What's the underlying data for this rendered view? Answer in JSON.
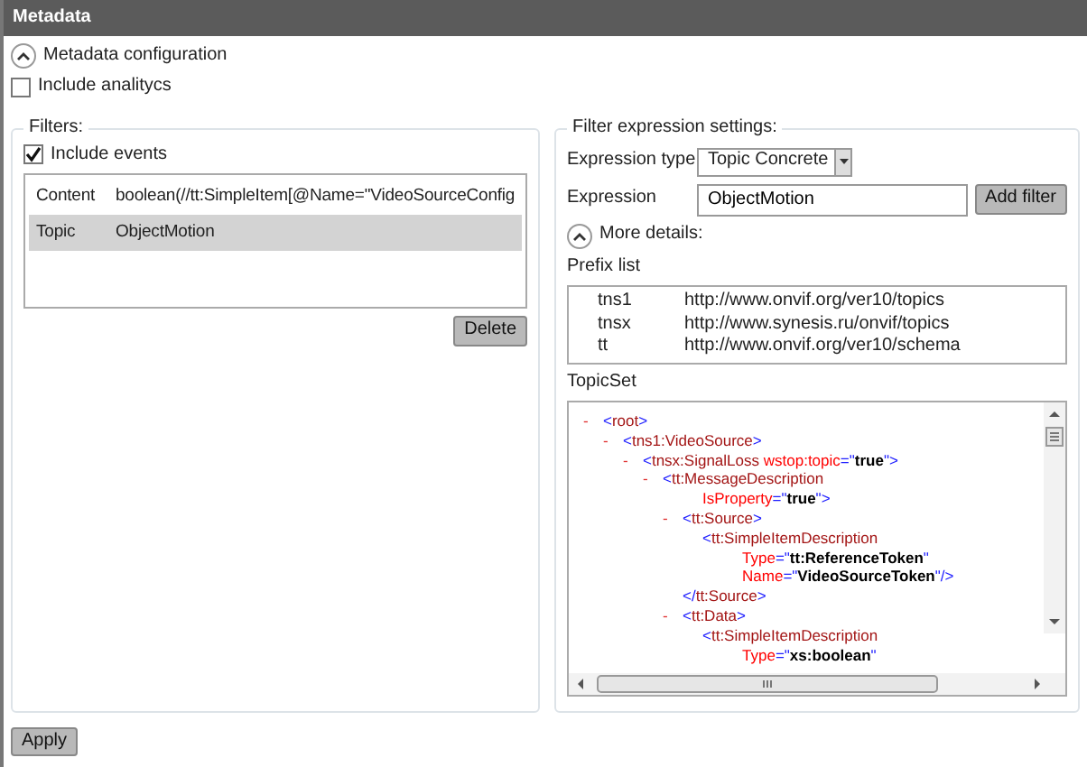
{
  "window": {
    "title": "Metadata"
  },
  "section": {
    "label": "Metadata configuration",
    "expanded": true
  },
  "include_analytics": {
    "label": "Include analitycs",
    "checked": false
  },
  "filters": {
    "legend": "Filters:",
    "include_events": {
      "label": "Include events",
      "checked": true
    },
    "rows": [
      {
        "type": "Content",
        "value": "boolean(//tt:SimpleItem[@Name=\"VideoSourceConfig",
        "selected": false
      },
      {
        "type": "Topic",
        "value": "ObjectMotion",
        "selected": true
      }
    ],
    "delete_button": "Delete"
  },
  "settings": {
    "legend": "Filter expression settings:",
    "expression_type": {
      "label": "Expression type",
      "value": "Topic  Concrete"
    },
    "expression": {
      "label": "Expression",
      "value": "ObjectMotion"
    },
    "add_button": "Add filter",
    "details": {
      "label": "More details:",
      "expanded": true
    },
    "prefix_list": {
      "label": "Prefix list",
      "rows": [
        {
          "prefix": "tns1",
          "uri": "http://www.onvif.org/ver10/topics"
        },
        {
          "prefix": "tnsx",
          "uri": "http://www.synesis.ru/onvif/topics"
        },
        {
          "prefix": "tt",
          "uri": "http://www.onvif.org/ver10/schema"
        }
      ]
    },
    "topicset": {
      "label": "TopicSet",
      "tree": [
        {
          "marker": "-",
          "lines": [
            [
              {
                "kind": "punct",
                "text": "<"
              },
              {
                "kind": "tag",
                "text": "root"
              },
              {
                "kind": "punct",
                "text": ">"
              }
            ]
          ],
          "children": [
            {
              "marker": "-",
              "lines": [
                [
                  {
                    "kind": "punct",
                    "text": "<"
                  },
                  {
                    "kind": "tag",
                    "text": "tns1:VideoSource"
                  },
                  {
                    "kind": "punct",
                    "text": ">"
                  }
                ]
              ],
              "children": [
                {
                  "marker": "-",
                  "lines": [
                    [
                      {
                        "kind": "punct",
                        "text": "<"
                      },
                      {
                        "kind": "tag",
                        "text": "tnsx:SignalLoss"
                      },
                      {
                        "kind": "attr",
                        "text": " wstop:topic"
                      },
                      {
                        "kind": "punct",
                        "text": "=\""
                      },
                      {
                        "kind": "value",
                        "text": "true"
                      },
                      {
                        "kind": "punct",
                        "text": "\">"
                      }
                    ]
                  ],
                  "children": [
                    {
                      "marker": "-",
                      "lines": [
                        [
                          {
                            "kind": "punct",
                            "text": "<"
                          },
                          {
                            "kind": "tag",
                            "text": "tt:MessageDescription"
                          }
                        ],
                        [
                          {
                            "kind": "attr",
                            "text": "IsProperty"
                          },
                          {
                            "kind": "punct",
                            "text": "=\""
                          },
                          {
                            "kind": "value",
                            "text": "true"
                          },
                          {
                            "kind": "punct",
                            "text": "\">"
                          }
                        ]
                      ],
                      "children": [
                        {
                          "marker": "-",
                          "lines": [
                            [
                              {
                                "kind": "punct",
                                "text": "<"
                              },
                              {
                                "kind": "tag",
                                "text": "tt:Source"
                              },
                              {
                                "kind": "punct",
                                "text": ">"
                              }
                            ]
                          ],
                          "children": [
                            {
                              "lines": [
                                [
                                  {
                                    "kind": "punct",
                                    "text": "<"
                                  },
                                  {
                                    "kind": "tag",
                                    "text": "tt:SimpleItemDescription"
                                  }
                                ],
                                [
                                  {
                                    "kind": "attr",
                                    "text": "Type"
                                  },
                                  {
                                    "kind": "punct",
                                    "text": "=\""
                                  },
                                  {
                                    "kind": "value",
                                    "text": "tt:ReferenceToken"
                                  },
                                  {
                                    "kind": "punct",
                                    "text": "\""
                                  }
                                ],
                                [
                                  {
                                    "kind": "attr",
                                    "text": "Name"
                                  },
                                  {
                                    "kind": "punct",
                                    "text": "=\""
                                  },
                                  {
                                    "kind": "value",
                                    "text": "VideoSourceToken"
                                  },
                                  {
                                    "kind": "punct",
                                    "text": "\"/>"
                                  }
                                ]
                              ]
                            }
                          ],
                          "close": [
                            {
                              "kind": "punct",
                              "text": "</"
                            },
                            {
                              "kind": "tag",
                              "text": "tt:Source"
                            },
                            {
                              "kind": "punct",
                              "text": ">"
                            }
                          ]
                        },
                        {
                          "marker": "-",
                          "lines": [
                            [
                              {
                                "kind": "punct",
                                "text": "<"
                              },
                              {
                                "kind": "tag",
                                "text": "tt:Data"
                              },
                              {
                                "kind": "punct",
                                "text": ">"
                              }
                            ]
                          ],
                          "children": [
                            {
                              "lines": [
                                [
                                  {
                                    "kind": "punct",
                                    "text": "<"
                                  },
                                  {
                                    "kind": "tag",
                                    "text": "tt:SimpleItemDescription"
                                  }
                                ],
                                [
                                  {
                                    "kind": "attr",
                                    "text": "Type"
                                  },
                                  {
                                    "kind": "punct",
                                    "text": "=\""
                                  },
                                  {
                                    "kind": "value",
                                    "text": "xs:boolean"
                                  },
                                  {
                                    "kind": "punct",
                                    "text": "\""
                                  }
                                ]
                              ]
                            }
                          ]
                        }
                      ]
                    }
                  ]
                }
              ]
            }
          ]
        }
      ]
    }
  },
  "apply_button": "Apply"
}
